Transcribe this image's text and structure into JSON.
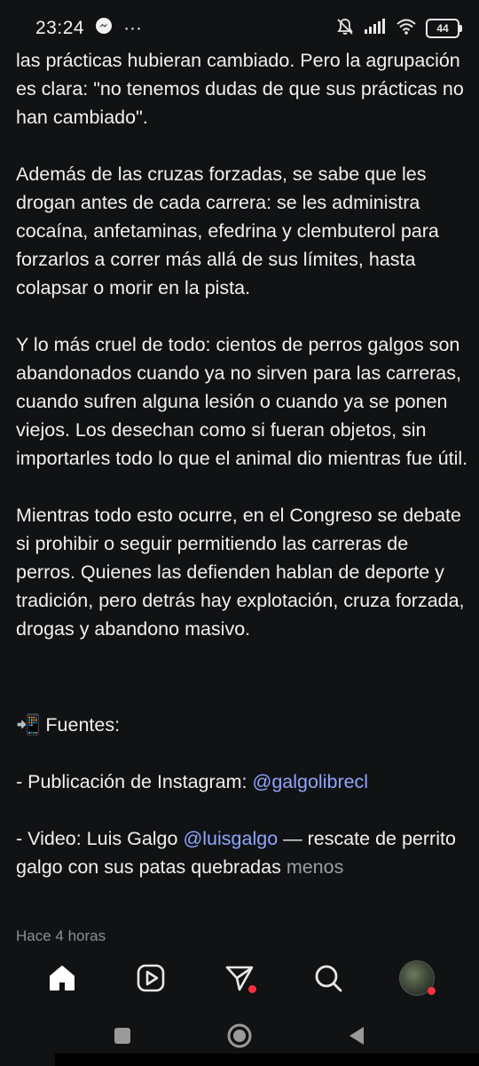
{
  "status_bar": {
    "time": "23:24",
    "dots": "···",
    "battery": "44",
    "icons": [
      "messenger-icon",
      "mute-bell-icon",
      "signal-icon",
      "wifi-icon",
      "battery-icon"
    ]
  },
  "post": {
    "partial_top": "las prácticas hubieran cambiado. Pero la agrupación es clara: \"no tenemos dudas de que sus prácticas no han cambiado\".",
    "paragraph_2": "Además de las cruzas forzadas, se sabe que les drogan antes de cada carrera: se les administra cocaína, anfetaminas, efedrina y clembuterol para forzarlos a correr más allá de sus límites, hasta colapsar o morir en la pista.",
    "paragraph_3": "Y lo más cruel de todo: cientos de perros galgos son abandonados cuando ya no sirven para las carreras, cuando sufren alguna lesión o cuando ya se ponen viejos. Los desechan como si fueran objetos, sin importarles todo lo que el animal dio mientras fue útil.",
    "paragraph_4": "Mientras todo esto ocurre, en el Congreso se debate si prohibir o seguir permitiendo las carreras de perros. Quienes las defienden hablan de deporte y tradición, pero detrás hay explotación, cruza forzada, drogas y abandono masivo.",
    "sources_emoji": "📲",
    "sources_title": "Fuentes:",
    "source_1_prefix": "- Publicación de Instagram: ",
    "source_1_mention": "galgolibrecl",
    "source_2_prefix": "- Video: Luis Galgo  ",
    "source_2_mention": "luisgalgo",
    "source_2_suffix": " — rescate de perrito galgo con sus patas quebradas ",
    "less_link": "menos",
    "timestamp": "Hace 4 horas"
  },
  "colors": {
    "background": "#101214",
    "mention": "#8fa6ff",
    "notification_dot": "#ff3040"
  }
}
